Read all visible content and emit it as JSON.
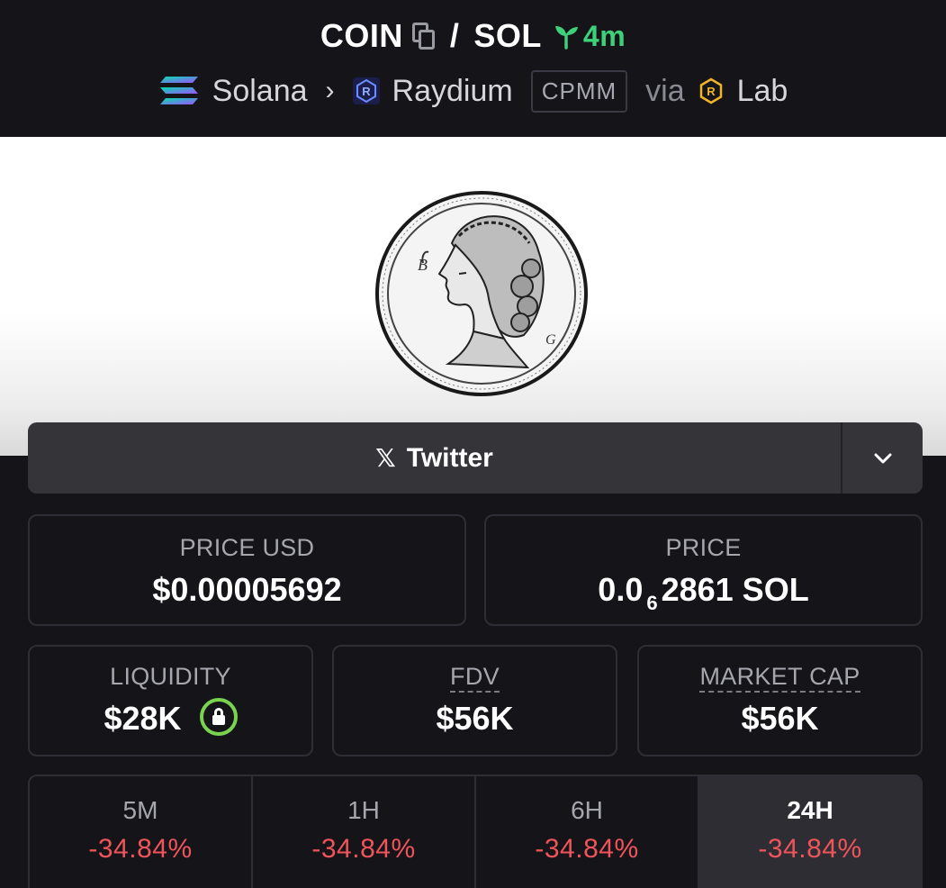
{
  "header": {
    "base_token": "COIN",
    "separator": "/",
    "quote_token": "SOL",
    "age": "4m",
    "chain": "Solana",
    "dex": "Raydium",
    "pool_type": "CPMM",
    "via": "via",
    "launchpad": "Lab",
    "icons": [
      "copy-icon",
      "sprout-icon",
      "solana-icon",
      "chevron-right-icon",
      "raydium-icon",
      "lab-icon"
    ]
  },
  "social": {
    "twitter_label": "Twitter",
    "x_glyph": "𝕏"
  },
  "stats": {
    "price_usd": {
      "label": "PRICE USD",
      "value": "$0.00005692"
    },
    "price_native": {
      "label": "PRICE",
      "prefix": "0.0",
      "subscript": "6",
      "suffix": "2861 SOL"
    },
    "liquidity": {
      "label": "LIQUIDITY",
      "value": "$28K"
    },
    "fdv": {
      "label": "FDV",
      "value": "$56K"
    },
    "market_cap": {
      "label": "MARKET CAP",
      "value": "$56K"
    }
  },
  "timeframes": [
    {
      "label": "5M",
      "change": "-34.84%"
    },
    {
      "label": "1H",
      "change": "-34.84%"
    },
    {
      "label": "6H",
      "change": "-34.84%"
    },
    {
      "label": "24H",
      "change": "-34.84%",
      "active": true
    }
  ],
  "colors": {
    "background": "#141419",
    "card_border": "#2e2e36",
    "age_green": "#3fd07a",
    "negative_red": "#f0545b",
    "lock_green": "#7ad34e",
    "active_tab": "#2d2d33"
  }
}
